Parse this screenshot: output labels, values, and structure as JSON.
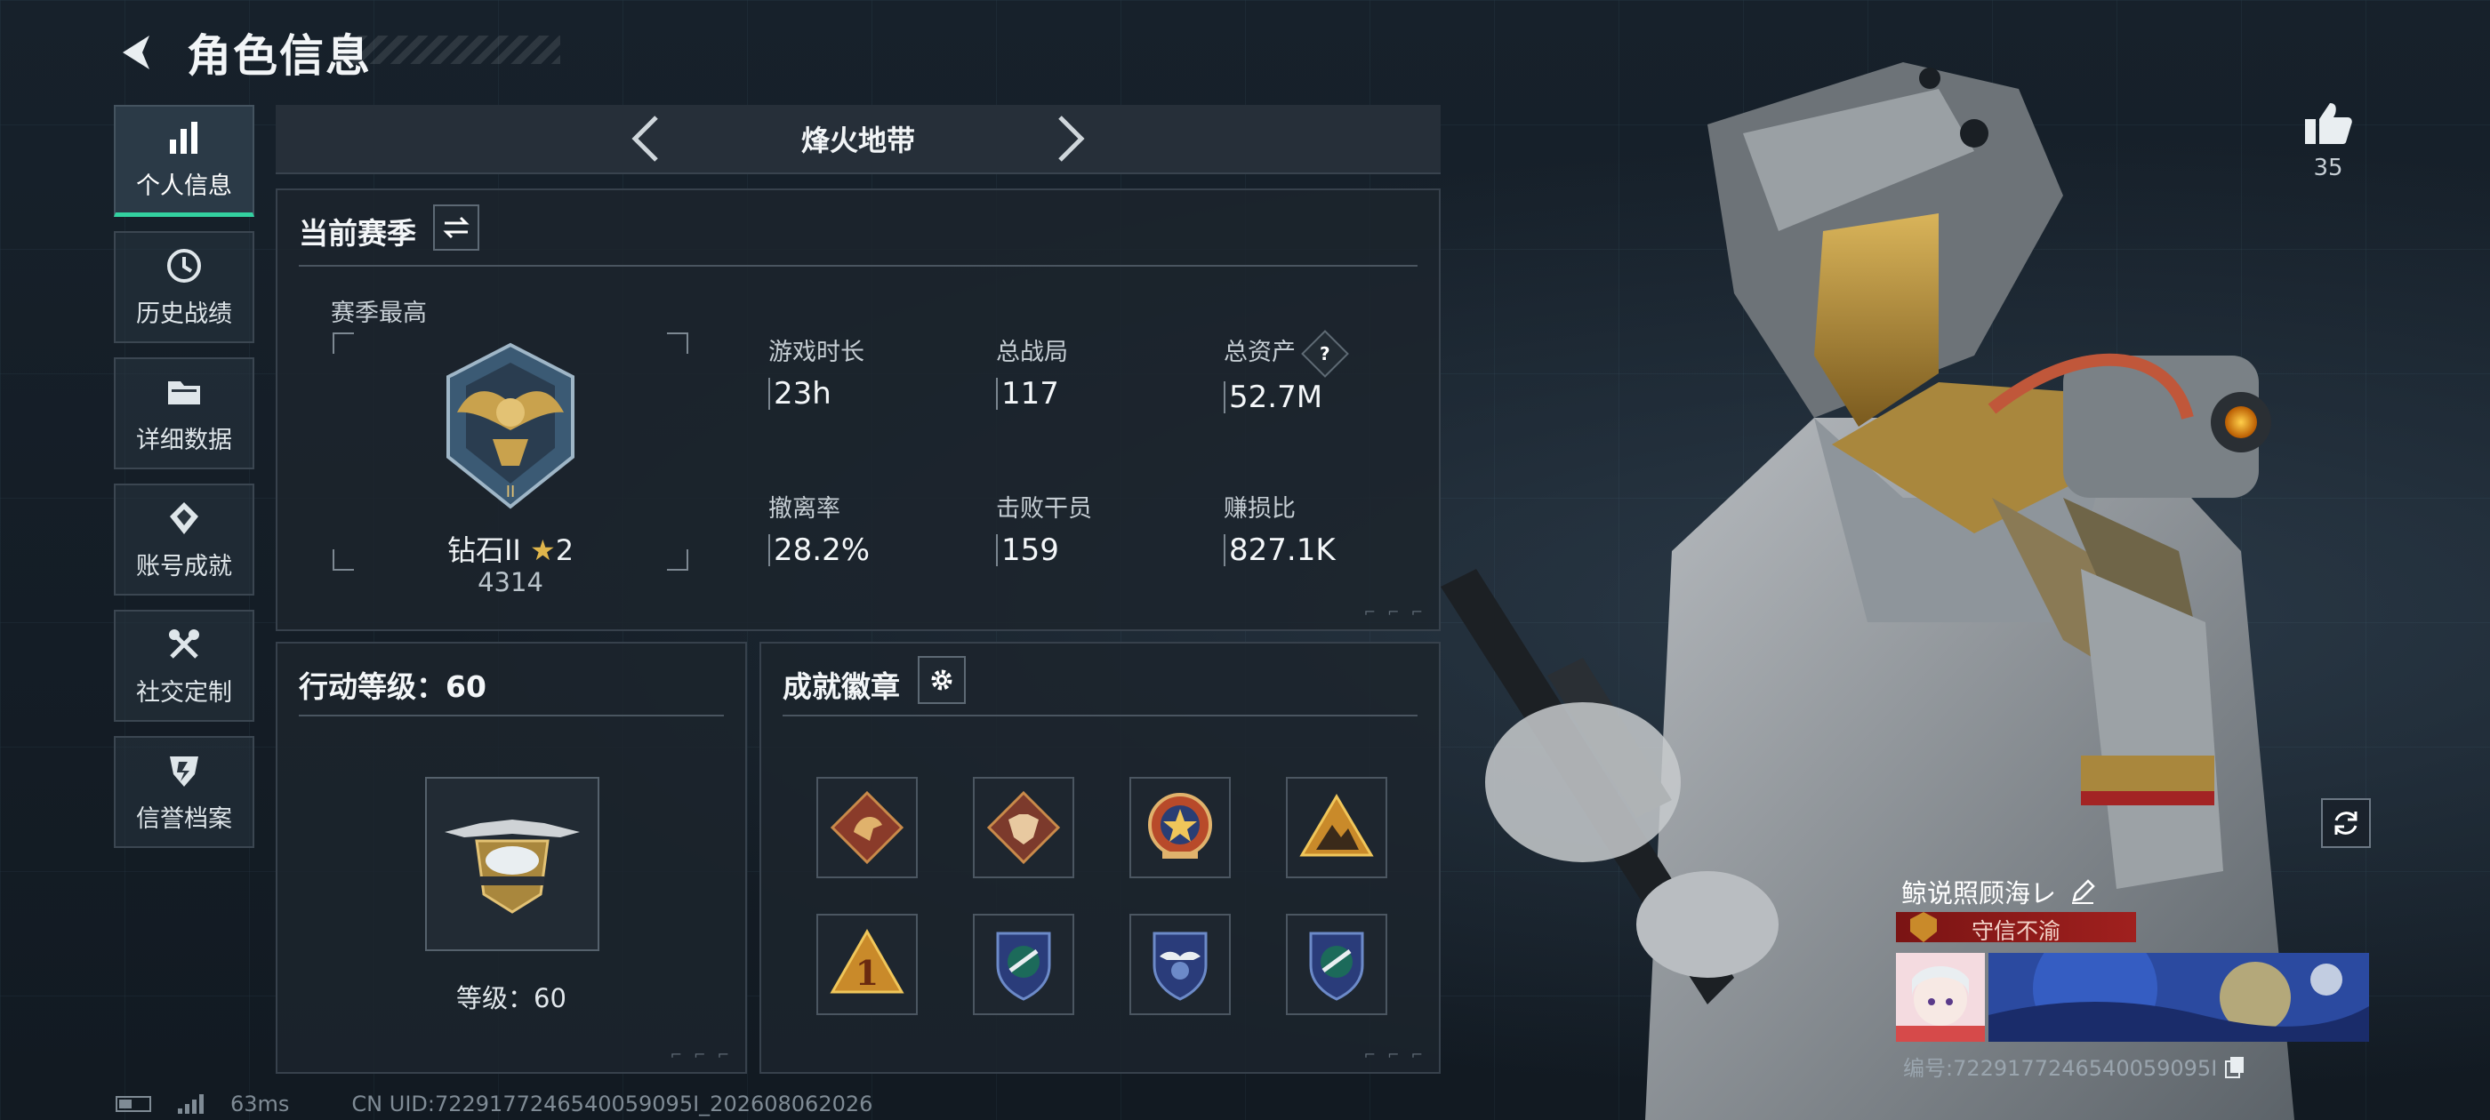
{
  "header": {
    "title": "角色信息"
  },
  "sidebar": {
    "items": [
      {
        "label": "个人信息",
        "icon": "bar-chart-icon",
        "active": true
      },
      {
        "label": "历史战绩",
        "icon": "history-icon"
      },
      {
        "label": "详细数据",
        "icon": "folder-icon"
      },
      {
        "label": "账号成就",
        "icon": "achievement-icon"
      },
      {
        "label": "社交定制",
        "icon": "tools-icon"
      },
      {
        "label": "信誉档案",
        "icon": "reputation-icon"
      }
    ]
  },
  "mode": {
    "title": "烽火地带"
  },
  "season": {
    "heading": "当前赛季",
    "best_label": "赛季最高",
    "rank_name": "钻石II",
    "rank_stars": "2",
    "rank_score": "4314",
    "stats": [
      {
        "label": "游戏时长",
        "value": "23h"
      },
      {
        "label": "总战局",
        "value": "117"
      },
      {
        "label": "总资产",
        "value": "52.7M",
        "help": "?"
      },
      {
        "label": "撤离率",
        "value": "28.2%"
      },
      {
        "label": "击败干员",
        "value": "159"
      },
      {
        "label": "赚损比",
        "value": "827.1K"
      }
    ]
  },
  "action_level": {
    "heading": "行动等级：60",
    "level_text": "等级：60"
  },
  "achievements": {
    "heading": "成就徽章",
    "badges": [
      "dragon-badge-icon",
      "wolf-badge-icon",
      "star-emblem-icon",
      "mountain-badge-icon",
      "number-one-badge-icon",
      "shield-crest-icon",
      "wing-crest-icon",
      "shield-crest-icon"
    ]
  },
  "footer": {
    "ping": "63ms",
    "uid": "CN UID:7229177246540059095I_202608062026"
  },
  "like": {
    "count": "35"
  },
  "card": {
    "name": "鲸说照顾海レ",
    "tag": "守信不渝",
    "id_text": "编号:7229177246540059095I"
  },
  "colors": {
    "accent": "#33d1a0",
    "tag_red": "#a0201e",
    "background": "#141c24"
  }
}
